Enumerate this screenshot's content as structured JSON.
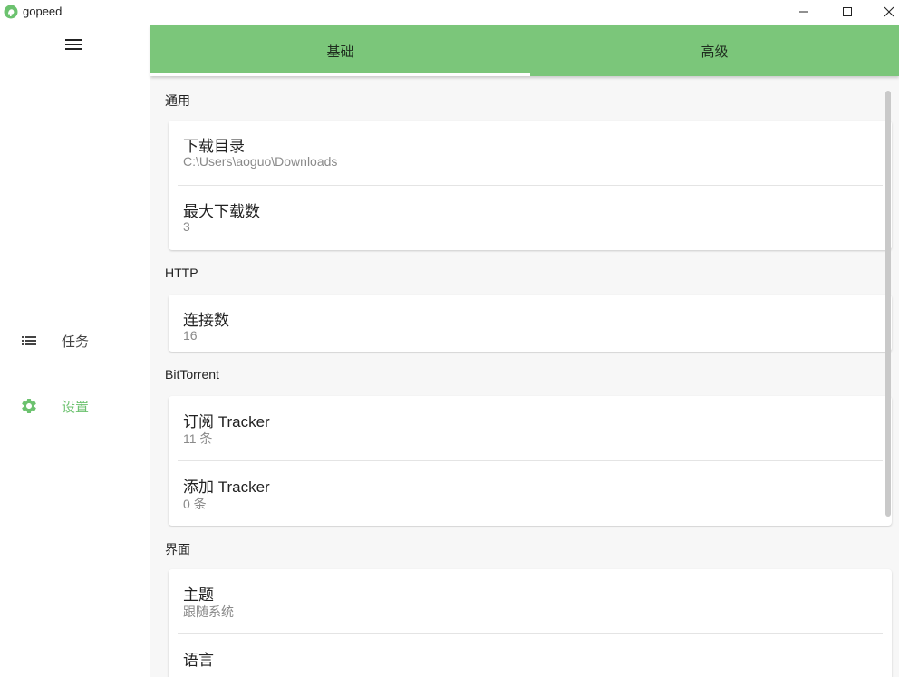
{
  "window": {
    "title": "gopeed",
    "controls": {
      "minimize": "minimize-icon",
      "maximize": "maximize-icon",
      "close": "close-icon"
    }
  },
  "colors": {
    "accent": "#7bc67a",
    "active_nav": "#6cc26f"
  },
  "sidebar": {
    "menu_icon": "hamburger-menu-icon",
    "items": [
      {
        "label": "任务",
        "icon": "list-icon"
      },
      {
        "label": "设置",
        "icon": "gear-icon"
      }
    ]
  },
  "tabs": [
    {
      "label": "基础",
      "active": true
    },
    {
      "label": "高级",
      "active": false
    }
  ],
  "sections": {
    "general": {
      "title": "通用",
      "items": [
        {
          "title": "下载目录",
          "value": "C:\\Users\\aoguo\\Downloads"
        },
        {
          "title": "最大下载数",
          "value": "3"
        }
      ]
    },
    "http": {
      "title": "HTTP",
      "items": [
        {
          "title": "连接数",
          "value": "16"
        }
      ]
    },
    "bittorrent": {
      "title": "BitTorrent",
      "items": [
        {
          "title": "订阅 Tracker",
          "value": "11 条"
        },
        {
          "title": "添加 Tracker",
          "value": "0 条"
        }
      ]
    },
    "ui": {
      "title": "界面",
      "items": [
        {
          "title": "主题",
          "value": "跟随系统"
        },
        {
          "title": "语言",
          "value": ""
        }
      ]
    }
  }
}
